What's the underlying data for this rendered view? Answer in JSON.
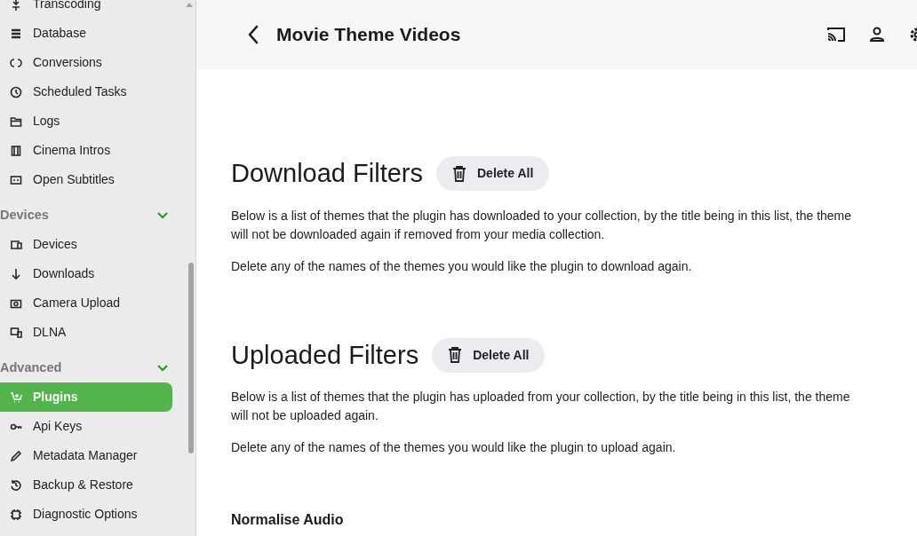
{
  "sidebar": {
    "sections": [
      {
        "items": [
          {
            "label": "Transcoding",
            "selected": false
          },
          {
            "label": "Database",
            "selected": false
          },
          {
            "label": "Conversions",
            "selected": false
          },
          {
            "label": "Scheduled Tasks",
            "selected": false
          },
          {
            "label": "Logs",
            "selected": false
          },
          {
            "label": "Cinema Intros",
            "selected": false
          },
          {
            "label": "Open Subtitles",
            "selected": false
          }
        ]
      },
      {
        "title": "Devices",
        "expanded": true,
        "items": [
          {
            "label": "Devices",
            "selected": false
          },
          {
            "label": "Downloads",
            "selected": false
          },
          {
            "label": "Camera Upload",
            "selected": false
          },
          {
            "label": "DLNA",
            "selected": false
          }
        ]
      },
      {
        "title": "Advanced",
        "expanded": true,
        "items": [
          {
            "label": "Plugins",
            "selected": true
          },
          {
            "label": "Api Keys",
            "selected": false
          },
          {
            "label": "Metadata Manager",
            "selected": false
          },
          {
            "label": "Backup & Restore",
            "selected": false
          },
          {
            "label": "Diagnostic Options",
            "selected": false
          }
        ]
      }
    ]
  },
  "header": {
    "title": "Movie Theme Videos"
  },
  "sections": [
    {
      "title": "Download Filters",
      "button": "Delete All",
      "paragraphs": [
        "Below is a list of themes that the plugin has downloaded to your collection, by the title being in this list, the theme will not be downloaded again if removed from your media collection.",
        "Delete any of the names of the themes you would like the plugin to download again."
      ]
    },
    {
      "title": "Uploaded Filters",
      "button": "Delete All",
      "paragraphs": [
        "Below is a list of themes that the plugin has uploaded from your collection, by the title being in this list, the theme will not be uploaded again.",
        "Delete any of the names of the themes you would like the plugin to upload again."
      ]
    }
  ],
  "subheading": "Normalise Audio"
}
